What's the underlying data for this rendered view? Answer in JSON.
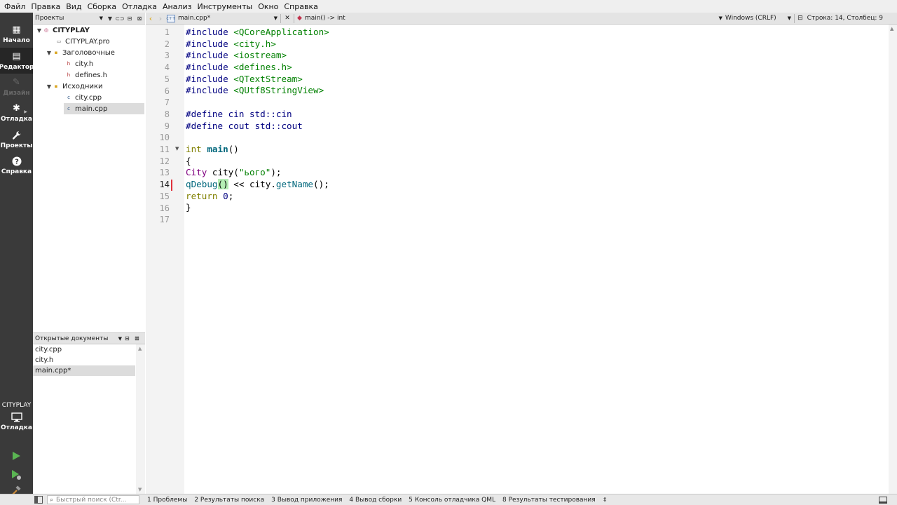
{
  "menu": [
    "Файл",
    "Правка",
    "Вид",
    "Сборка",
    "Отладка",
    "Анализ",
    "Инструменты",
    "Окно",
    "Справка"
  ],
  "modes": [
    {
      "label": "Начало",
      "icon": "grid-icon",
      "glyph": "▦"
    },
    {
      "label": "Редактор",
      "icon": "editor-icon",
      "glyph": "▤"
    },
    {
      "label": "Дизайн",
      "icon": "pencil-icon",
      "glyph": "✎"
    },
    {
      "label": "Отладка",
      "icon": "bug-icon",
      "glyph": "✱"
    },
    {
      "label": "Проекты",
      "icon": "wrench-icon",
      "glyph": "🔧"
    },
    {
      "label": "Справка",
      "icon": "help-icon",
      "glyph": "?"
    }
  ],
  "kit": {
    "project": "CITYPLAY",
    "label": "Отладка"
  },
  "projects_panel": {
    "title": "Проекты",
    "tree": [
      {
        "label": "CITYPLAY",
        "icon": "project-icon",
        "glyph": "◎"
      },
      {
        "label": "CITYPLAY.pro",
        "icon": "pro-file-icon",
        "glyph": "▭"
      },
      {
        "label": "Заголовочные",
        "icon": "folder-icon",
        "glyph": "▪"
      },
      {
        "label": "city.h",
        "icon": "header-file-icon",
        "glyph": "h"
      },
      {
        "label": "defines.h",
        "icon": "header-file-icon",
        "glyph": "h"
      },
      {
        "label": "Исходники",
        "icon": "folder-icon",
        "glyph": "▪"
      },
      {
        "label": "city.cpp",
        "icon": "cpp-file-icon",
        "glyph": "c"
      },
      {
        "label": "main.cpp",
        "icon": "cpp-file-icon",
        "glyph": "c"
      }
    ]
  },
  "open_docs": {
    "title": "Открытые документы",
    "items": [
      "city.cpp",
      "city.h",
      "main.cpp*"
    ]
  },
  "editor": {
    "file_tab": "main.cpp*",
    "cpp_icon_text": "c++",
    "function": "main() -> int",
    "line_ending": "Windows (CRLF)",
    "cursor": "Строка: 14, Столбец: 9",
    "line_numbers": [
      "1",
      "2",
      "3",
      "4",
      "5",
      "6",
      "7",
      "8",
      "9",
      "10",
      "11",
      "12",
      "13",
      "14",
      "15",
      "16",
      "17"
    ],
    "code": {
      "pp": "#include ",
      "l1": "<QCoreApplication>",
      "l2": "<city.h>",
      "l3": "<iostream>",
      "l4": "<defines.h>",
      "l5": "<QTextStream>",
      "l6": "<QUtf8StringView>",
      "l8": "#define cin std::cin",
      "l9": "#define cout std::cout",
      "l11_kw": "int",
      "l11_fn": "main",
      "l11_rest": "()",
      "l12": "{",
      "l13_cls": "City",
      "l13_var": " city(",
      "l13_str": "\"ього\"",
      "l13_end": ");",
      "l14_fn": "qDebug",
      "l14_paren": "()",
      "l14_mid": " << city.",
      "l14_call": "getName",
      "l14_end": "();",
      "l15_kw": "return",
      "l15_num": "0",
      "l15_end": ";",
      "l16": "}"
    }
  },
  "statusbar": {
    "search_placeholder": "Быстрый поиск (Ctr...",
    "panes": [
      "1 Проблемы",
      "2 Результаты поиска",
      "3 Вывод приложения",
      "4 Вывод сборки",
      "5 Консоль отладчика QML",
      "8 Результаты тестирования"
    ]
  }
}
